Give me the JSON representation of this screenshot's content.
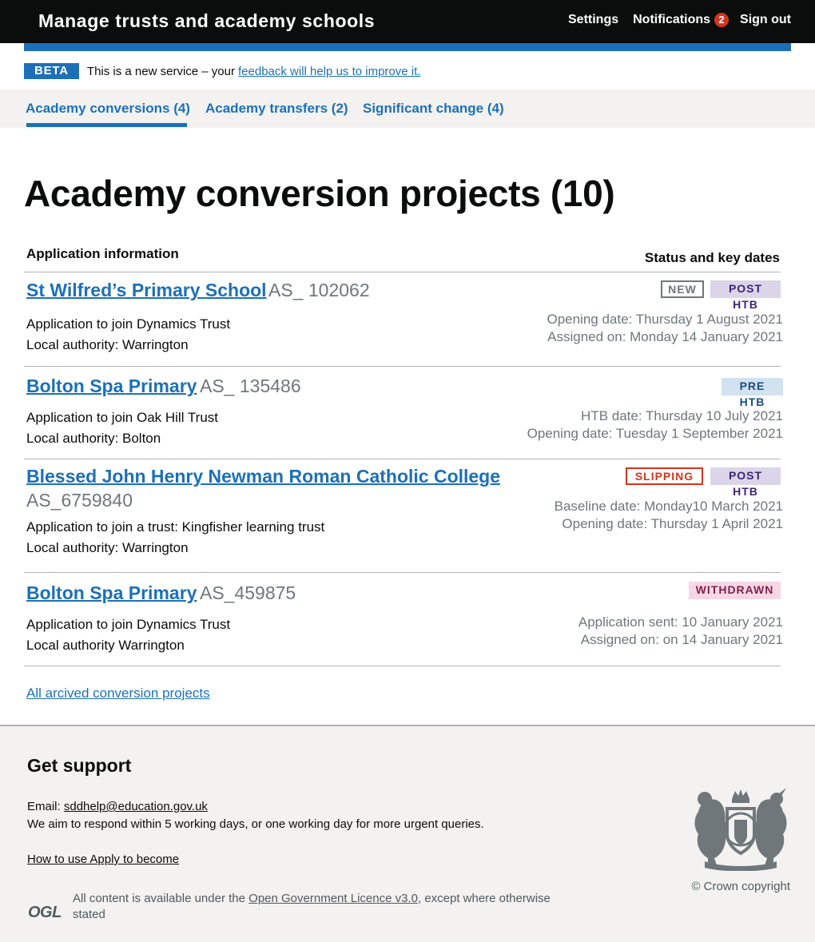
{
  "header": {
    "title": "Manage trusts and academy schools",
    "settings_label": "Settings",
    "notifications_label": "Notifications",
    "notifications_count": "2",
    "signout_label": "Sign out"
  },
  "phase": {
    "tag": "BETA",
    "text": "This is a new service – your",
    "link": "feedback will help us to improve it."
  },
  "subnav": {
    "items": [
      {
        "label": "Academy conversions (4)"
      },
      {
        "label": "Academy transfers (2)"
      },
      {
        "label": "Significant change (4)"
      }
    ]
  },
  "main": {
    "title": "Academy conversion projects (10)",
    "col_left": "Application information",
    "col_right": "Status and key dates",
    "projects": [
      {
        "name": "St Wilfred’s Primary School",
        "ref": "AS_ 102062",
        "line1": "Application to join Dynamics Trust",
        "line2": "Local authority: Warrington",
        "tags": [
          "NEW",
          "POST HTB"
        ],
        "date1": "Opening date:  Thursday 1 August 2021",
        "date2": "Assigned on:  Monday 14 January 2021"
      },
      {
        "name": "Bolton Spa Primary",
        "ref": "AS_ 135486",
        "line1": "Application to join Oak Hill Trust",
        "line2": "Local authority: Bolton",
        "tags": [
          "PRE HTB"
        ],
        "date1": "HTB date: Thursday 10 July 2021",
        "date2": "Opening date: Tuesday 1 September 2021"
      },
      {
        "name": "Blessed John Henry Newman Roman Catholic College",
        "ref": "AS_6759840",
        "line1": "Application to join a trust: Kingfisher learning trust",
        "line2": "Local authority: Warrington",
        "tags": [
          "SLIPPING",
          "POST HTB"
        ],
        "date1": "Baseline date:   Monday10 March 2021",
        "date2": "Opening date: Thursday 1 April 2021"
      },
      {
        "name": "Bolton Spa Primary",
        "ref": "AS_459875",
        "line1": "Application to join Dynamics Trust",
        "line2": "Local authority Warrington",
        "tags": [
          "WITHDRAWN"
        ],
        "date1": "Application sent: 10 January 2021",
        "date2": "Assigned on: on 14 January 2021"
      }
    ],
    "archive_link": "All arcived conversion projects"
  },
  "footer": {
    "support_title": "Get support",
    "email_label": "Email:",
    "email": "sddhelp@education.gov.uk",
    "response_text": "We aim to respond within 5 working days, or one working day for more urgent queries.",
    "how_to_link": "How to use Apply to become",
    "ogl": "OGL",
    "licence_prefix": "All content is available under the",
    "licence_link": "Open Government Licence v3.0",
    "licence_suffix": ", except where otherwise stated",
    "copyright": "© Crown copyright"
  },
  "colors": {
    "header_bg": "#0b0c0c",
    "brand_blue": "#1d70b8",
    "link": "#1d70b8",
    "footer_bg": "#f3f2f1",
    "badge_red": "#d4351c"
  }
}
